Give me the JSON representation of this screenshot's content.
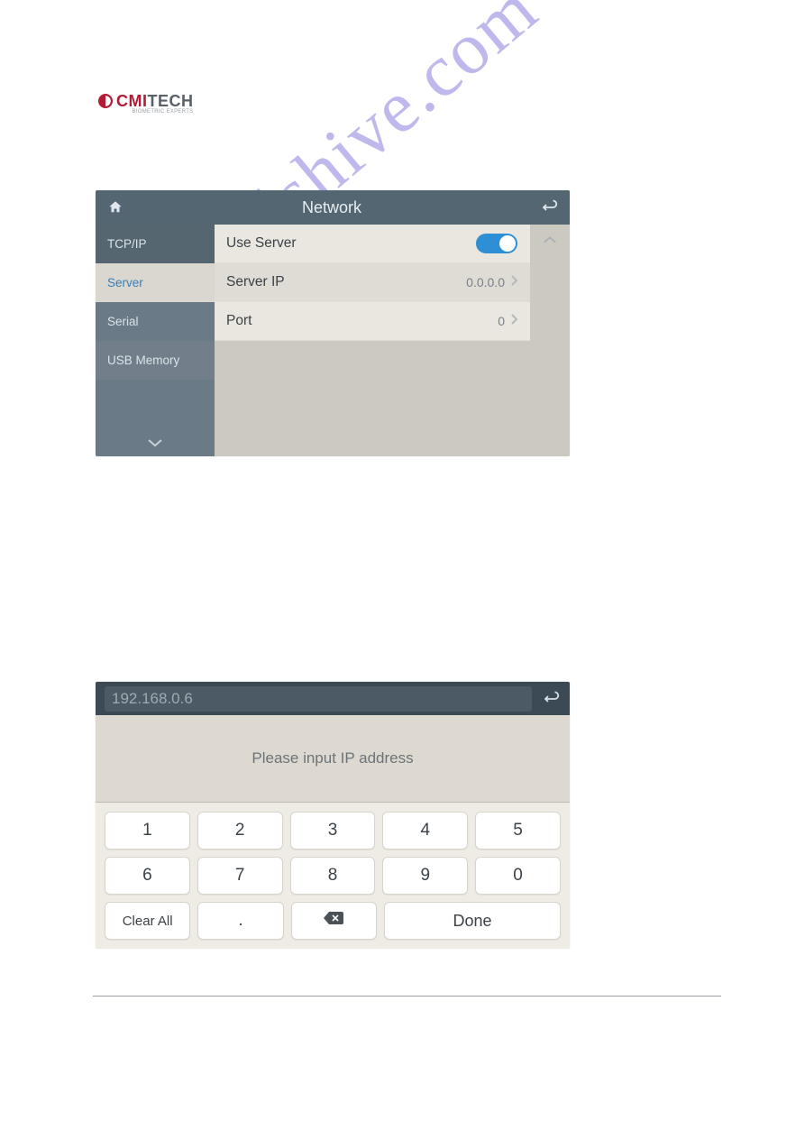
{
  "logo": {
    "brand1": "CMI",
    "brand2": "TECH",
    "tagline": "BIOMETRIC EXPERTS"
  },
  "watermark": "manualshive.com",
  "network": {
    "title": "Network",
    "sidebar": {
      "items": [
        {
          "label": "TCP/IP"
        },
        {
          "label": "Server"
        },
        {
          "label": "Serial"
        },
        {
          "label": "USB Memory"
        }
      ]
    },
    "rows": {
      "use_server": {
        "label": "Use Server",
        "on": true
      },
      "server_ip": {
        "label": "Server IP",
        "value": "0.0.0.0"
      },
      "port": {
        "label": "Port",
        "value": "0"
      }
    }
  },
  "ip_screen": {
    "input_value": "192.168.0.6",
    "prompt": "Please input IP address",
    "keys": {
      "row1": [
        "1",
        "2",
        "3",
        "4",
        "5"
      ],
      "row2": [
        "6",
        "7",
        "8",
        "9",
        "0"
      ],
      "clear": "Clear All",
      "dot": ".",
      "done": "Done"
    }
  }
}
